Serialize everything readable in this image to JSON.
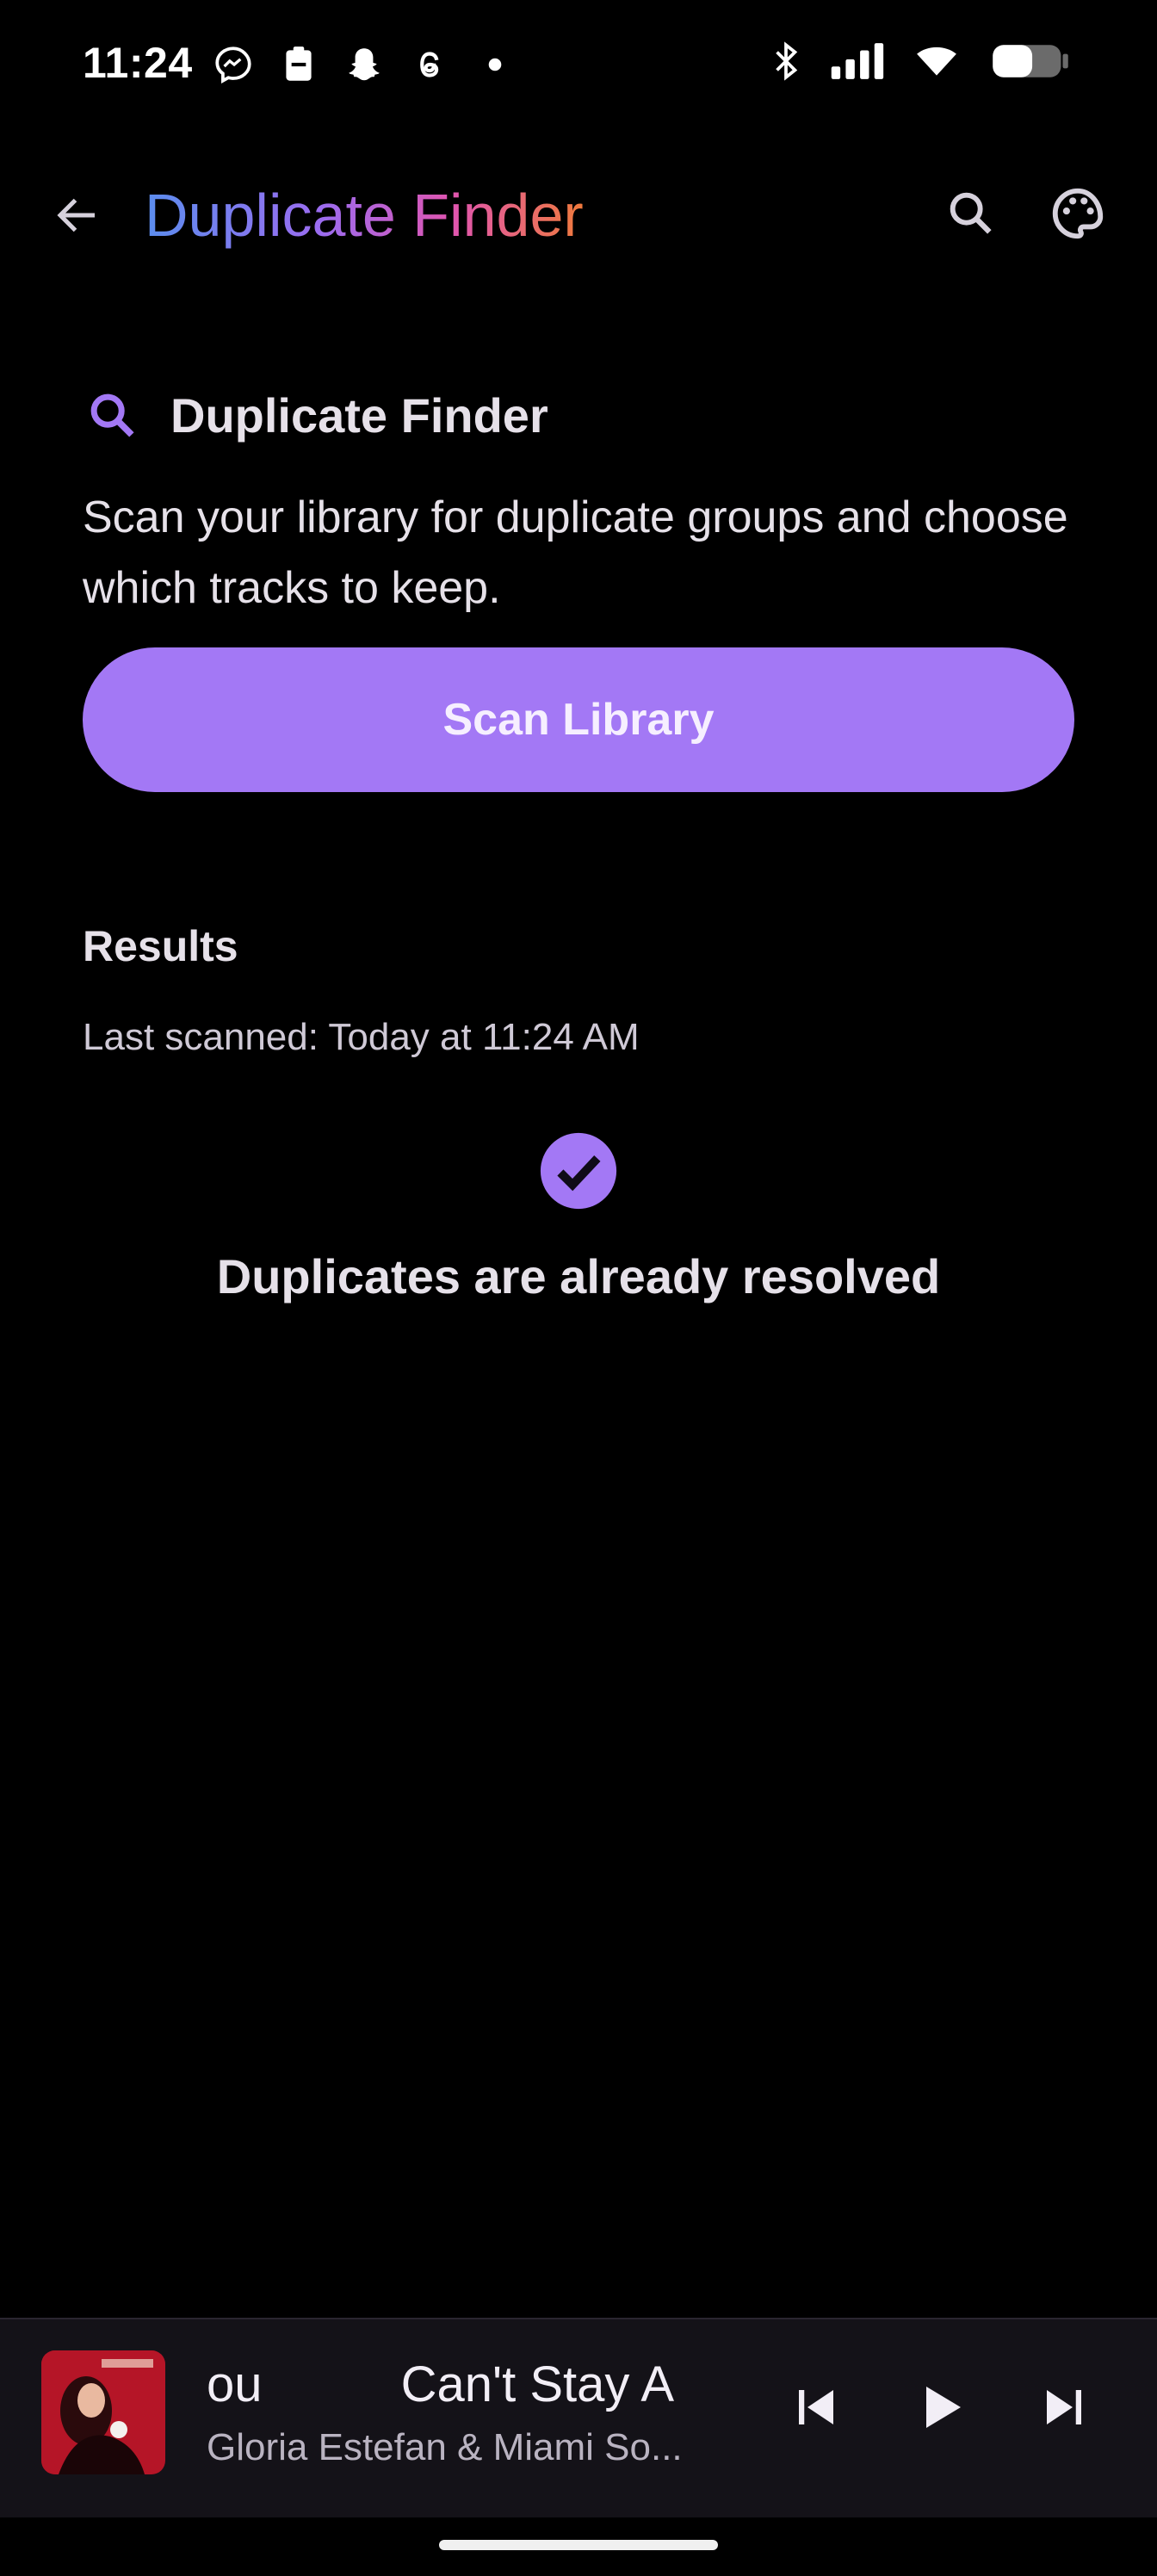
{
  "status_bar": {
    "time": "11:24",
    "left_icons": [
      "messenger-icon",
      "clipboard-icon",
      "snapchat-icon",
      "threads-icon",
      "dot-icon"
    ],
    "right_icons": [
      "bluetooth-icon",
      "signal-icon",
      "wifi-icon",
      "battery-icon"
    ]
  },
  "app_bar": {
    "title": "Duplicate Finder",
    "back_icon": "arrow-back-icon",
    "actions": [
      "search-icon",
      "palette-icon"
    ]
  },
  "section": {
    "icon": "search-icon",
    "title": "Duplicate Finder",
    "description": "Scan your library for duplicate groups and choose which tracks to keep.",
    "scan_button_label": "Scan Library"
  },
  "results": {
    "title": "Results",
    "last_scanned": "Last scanned: Today at 11:24 AM",
    "status_icon": "check-circle-icon",
    "status_text": "Duplicates are already resolved"
  },
  "mini_player": {
    "track_title_visible": "ou          Can't Stay A",
    "artist": "Gloria Estefan & Miami So...",
    "controls": [
      "skip-previous-icon",
      "play-icon",
      "skip-next-icon"
    ]
  },
  "colors": {
    "accent": "#a378f5",
    "background": "#000000",
    "player_bg": "#141218"
  }
}
